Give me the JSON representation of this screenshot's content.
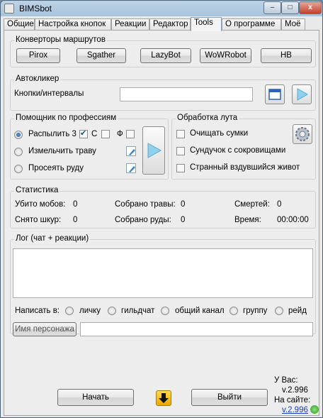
{
  "window": {
    "title": "BIMSbot",
    "min": "–",
    "max": "□",
    "close": "x"
  },
  "tabs": [
    "Общие",
    "Настройка кнопок",
    "Реакции",
    "Редактор",
    "Tools",
    "О программе",
    "Моё"
  ],
  "converters": {
    "title": "Конверторы маршрутов",
    "buttons": [
      "Pirox",
      "Sgather",
      "LazyBot",
      "WoWRobot",
      "HB"
    ]
  },
  "autoclicker": {
    "title": "Автокликер",
    "label": "Кнопки/интервалы",
    "value": ""
  },
  "professions": {
    "title": "Помощник по профессиям",
    "spray": "Распылить 3",
    "c_label": "С",
    "f_label": "Ф",
    "grind": "Измельчить траву",
    "sift": "Просеять руду"
  },
  "loot": {
    "title": "Обработка лута",
    "items": [
      "Очищать сумки",
      "Сундучок с сокровищами",
      "Странный вздувшийся живот"
    ]
  },
  "stats": {
    "title": "Статистика",
    "mobs_label": "Убито мобов:",
    "mobs": "0",
    "herbs_label": "Собрано травы:",
    "herbs": "0",
    "deaths_label": "Смертей:",
    "deaths": "0",
    "skins_label": "Снято шкур:",
    "skins": "0",
    "ore_label": "Собрано руды:",
    "ore": "0",
    "time_label": "Время:",
    "time": "00:00:00"
  },
  "log": {
    "title": "Лог (чат + реакции)",
    "write_to": "Написать в:",
    "channels": [
      "личку",
      "гильдчат",
      "общий канал",
      "группу",
      "рейд"
    ],
    "char_placeholder": "Имя персонажа"
  },
  "footer": {
    "start": "Начать",
    "exit": "Выйти",
    "you_have": "У Вас:",
    "local_version": "v.2.996",
    "on_site": "На сайте:",
    "site_version": "v.2.996"
  }
}
